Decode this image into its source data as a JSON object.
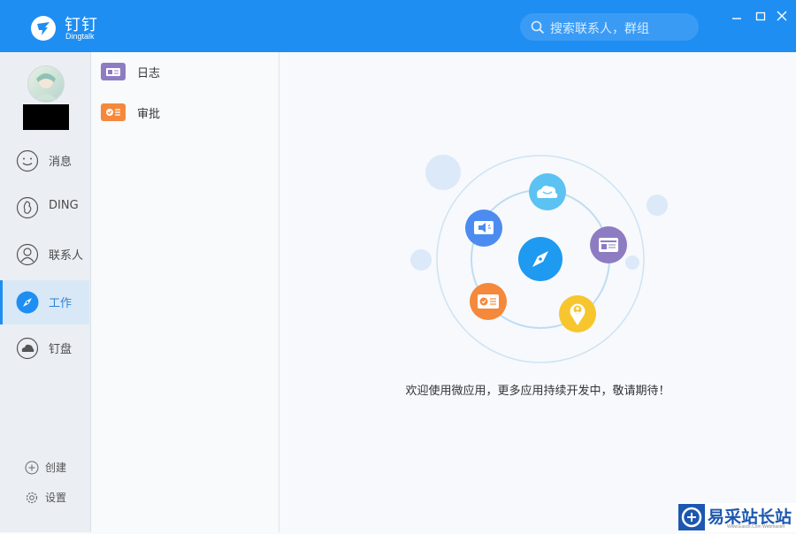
{
  "app": {
    "title": "钉钉",
    "subtitle": "Dingtalk"
  },
  "search": {
    "placeholder": "搜索联系人，群组"
  },
  "sidebar": {
    "items": [
      {
        "label": "消息",
        "icon": "smile-icon"
      },
      {
        "label": "DING",
        "icon": "ding-icon"
      },
      {
        "label": "联系人",
        "icon": "contacts-icon"
      },
      {
        "label": "工作",
        "icon": "compass-icon",
        "active": true
      },
      {
        "label": "钉盘",
        "icon": "cloud-disk-icon"
      }
    ],
    "bottom": [
      {
        "label": "创建",
        "icon": "plus-circle-icon"
      },
      {
        "label": "设置",
        "icon": "gear-icon"
      }
    ]
  },
  "apps": [
    {
      "label": "日志",
      "icon": "log-icon",
      "color": "#8e7cc3"
    },
    {
      "label": "审批",
      "icon": "approval-icon",
      "color": "#f5883b"
    }
  ],
  "main": {
    "empty_text": "欢迎使用微应用，更多应用持续开发中，敬请期待！"
  },
  "colors": {
    "brand": "#1f8ef2",
    "cloud": "#5cc2f2",
    "log": "#8e7cc3",
    "approval": "#f5883b",
    "location": "#f7c52e",
    "announce": "#4c8cf0"
  },
  "watermark": {
    "text": "易采站长站",
    "sub": "Www.Easck.Com  Webmaster"
  }
}
